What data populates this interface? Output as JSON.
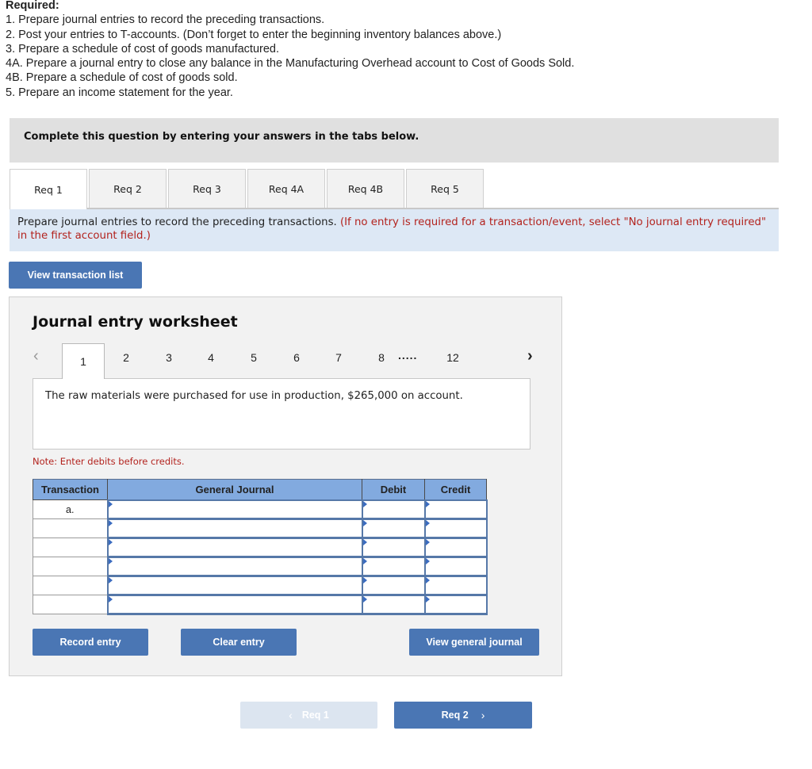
{
  "required": {
    "heading": "Required:",
    "items": [
      "1. Prepare journal entries to record the preceding transactions.",
      "2. Post your entries to T-accounts. (Don’t forget to enter the beginning inventory balances above.)",
      "3. Prepare a schedule of cost of goods manufactured.",
      "4A. Prepare a journal entry to close any balance in the Manufacturing Overhead account to Cost of Goods Sold.",
      "4B. Prepare a schedule of cost of goods sold.",
      "5. Prepare an income statement for the year."
    ]
  },
  "instruction_bar": "Complete this question by entering your answers in the tabs below.",
  "tabs": [
    {
      "label": "Req 1",
      "active": true
    },
    {
      "label": "Req 2",
      "active": false
    },
    {
      "label": "Req 3",
      "active": false
    },
    {
      "label": "Req 4A",
      "active": false
    },
    {
      "label": "Req 4B",
      "active": false
    },
    {
      "label": "Req 5",
      "active": false
    }
  ],
  "prompt": {
    "main": "Prepare journal entries to record the preceding transactions. ",
    "note": "(If no entry is required for a transaction/event, select \"No journal entry required\" in the first account field.)"
  },
  "view_transaction_list_label": "View transaction list",
  "worksheet": {
    "title": "Journal entry worksheet",
    "pager": {
      "prev_icon": "‹",
      "next_icon": "›",
      "pages": [
        "1",
        "2",
        "3",
        "4",
        "5",
        "6",
        "7",
        "8"
      ],
      "ellipsis": ".....",
      "last_page": "12",
      "active_page": "1"
    },
    "description": "The raw materials were purchased for use in production, $265,000 on account.",
    "note": "Note: Enter debits before credits.",
    "table": {
      "headers": {
        "transaction": "Transaction",
        "journal": "General Journal",
        "debit": "Debit",
        "credit": "Credit"
      },
      "rows": [
        {
          "transaction": "a.",
          "account": "",
          "debit": "",
          "credit": ""
        },
        {
          "transaction": "",
          "account": "",
          "debit": "",
          "credit": ""
        },
        {
          "transaction": "",
          "account": "",
          "debit": "",
          "credit": ""
        },
        {
          "transaction": "",
          "account": "",
          "debit": "",
          "credit": ""
        },
        {
          "transaction": "",
          "account": "",
          "debit": "",
          "credit": ""
        },
        {
          "transaction": "",
          "account": "",
          "debit": "",
          "credit": ""
        }
      ]
    },
    "buttons": {
      "record": "Record entry",
      "clear": "Clear entry",
      "view_general_journal": "View general journal"
    }
  },
  "navigation": {
    "prev_label": "Req 1",
    "prev_icon": "‹",
    "prev_disabled": true,
    "next_label": "Req 2",
    "next_icon": "›"
  },
  "colors": {
    "button_blue": "#4a76b4",
    "header_blue": "#82aadf",
    "prompt_bg": "#dde8f5",
    "note_red": "#b3231e",
    "disabled_button": "#dce5f0"
  }
}
